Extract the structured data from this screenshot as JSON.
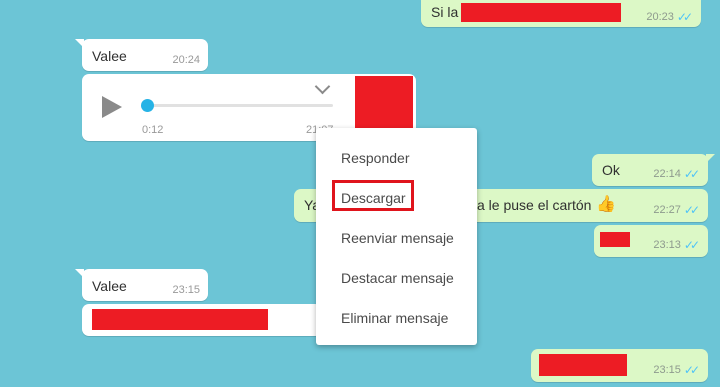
{
  "colors": {
    "wallpaper": "#6cc5d6",
    "incoming_bubble": "#ffffff",
    "outgoing_bubble": "#dcf8c6",
    "redaction": "#ed1c24",
    "read_ticks": "#4fc3f7",
    "audio_accent": "#26b3e6"
  },
  "messages": [
    {
      "direction": "out",
      "text": "Si la",
      "time": "20:23",
      "status": "read"
    },
    {
      "direction": "in",
      "text": "Valee",
      "time": "20:24"
    },
    {
      "direction": "in",
      "type": "audio",
      "elapsed": "0:12",
      "time": "21:07",
      "progress": 0.0
    },
    {
      "direction": "out",
      "text": "Ok",
      "time": "22:14",
      "status": "read"
    },
    {
      "direction": "out",
      "text_start": "Ya",
      "text_end": "a le puse el cartón",
      "emoji": "👍",
      "time": "22:27",
      "status": "read"
    },
    {
      "direction": "out",
      "text": "",
      "time": "23:13",
      "status": "read"
    },
    {
      "direction": "in",
      "text": "Valee",
      "time": "23:15"
    },
    {
      "direction": "in",
      "text": ""
    },
    {
      "direction": "out",
      "text": "",
      "time": "23:15",
      "status": "read"
    }
  ],
  "context_menu": {
    "items": [
      "Responder",
      "Descargar",
      "Reenviar mensaje",
      "Destacar mensaje",
      "Eliminar mensaje"
    ],
    "highlighted": "Descargar"
  },
  "icons": {
    "read_ticks": "double-check-icon",
    "play": "play-icon",
    "chevron": "chevron-down-icon"
  }
}
